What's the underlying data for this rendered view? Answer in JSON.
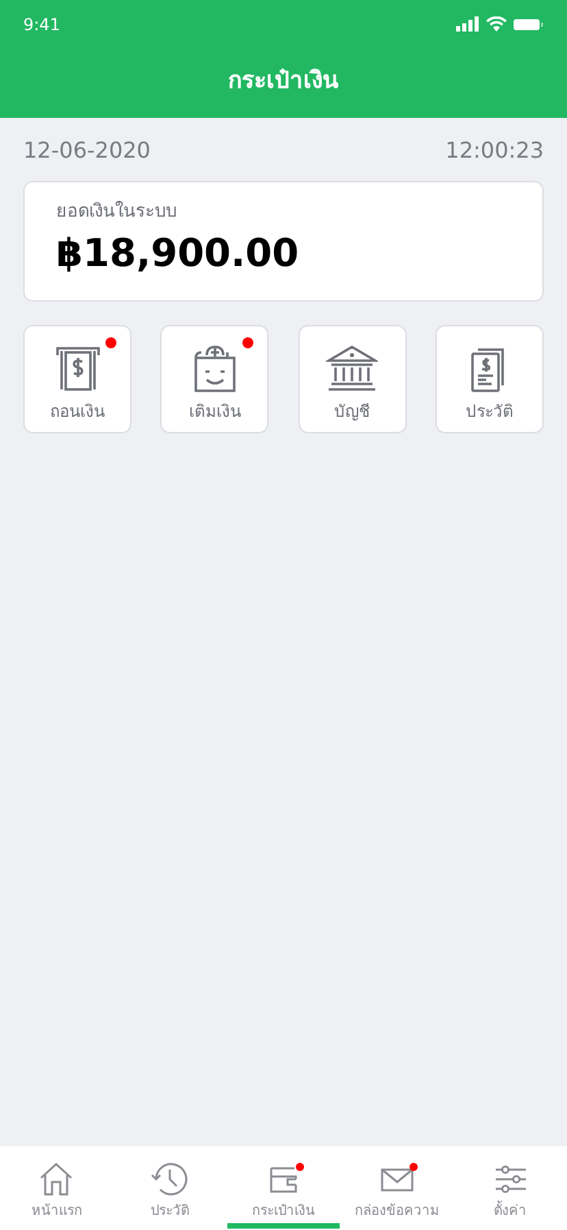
{
  "status_bar": {
    "time": "9:41"
  },
  "header": {
    "title": "กระเป๋าเงิน"
  },
  "date": "12-06-2020",
  "time": "12:00:23",
  "balance": {
    "label": "ยอดเงินในระบบ",
    "amount": "฿18,900.00"
  },
  "actions": [
    {
      "label": "ถอนเงิน",
      "badge": true
    },
    {
      "label": "เติมเงิน",
      "badge": true
    },
    {
      "label": "บัญชี",
      "badge": false
    },
    {
      "label": "ประวัติ",
      "badge": false
    }
  ],
  "tabs": [
    {
      "label": "หน้าแรก",
      "selected": false,
      "badge": false
    },
    {
      "label": "ประวัติ",
      "selected": false,
      "badge": false
    },
    {
      "label": "กระเป๋าเงิน",
      "selected": true,
      "badge": true
    },
    {
      "label": "กล่องข้อความ",
      "selected": false,
      "badge": true
    },
    {
      "label": "ตั้งค่า",
      "selected": false,
      "badge": false
    }
  ]
}
